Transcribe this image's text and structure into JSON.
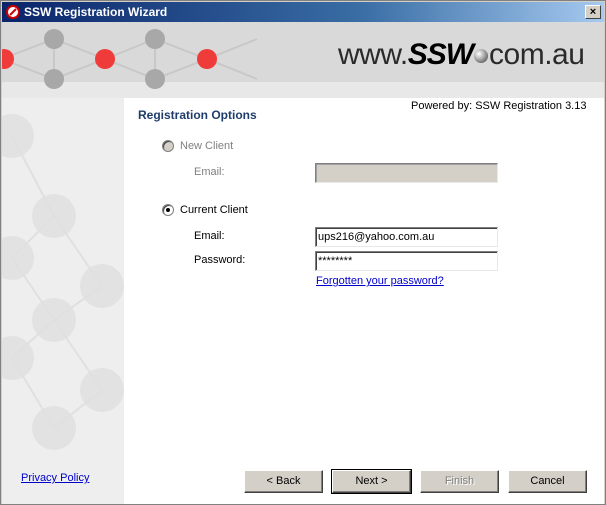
{
  "window": {
    "title": "SSW Registration Wizard",
    "close_glyph": "×"
  },
  "banner": {
    "logo_prefix": "www.",
    "logo_brand": "SSW",
    "logo_suffix": "com.au"
  },
  "header": {
    "powered_by": "Powered by: SSW Registration 3.13",
    "section_title": "Registration Options"
  },
  "form": {
    "new_client": {
      "label": "New Client",
      "selected": false,
      "enabled": false,
      "email_label": "Email:",
      "email_value": ""
    },
    "current_client": {
      "label": "Current Client",
      "selected": true,
      "email_label": "Email:",
      "email_value": "ups216@yahoo.com.au",
      "password_label": "Password:",
      "password_value": "********",
      "forgot_link": "Forgotten your password?"
    }
  },
  "footer": {
    "privacy_link": "Privacy Policy",
    "back_label": "< Back",
    "next_label": "Next >",
    "finish_label": "Finish",
    "cancel_label": "Cancel"
  },
  "colors": {
    "title_gradient_start": "#0a246a",
    "section_title": "#1f3d6b",
    "banner_red_dot": "#f03b3b",
    "banner_grey_dot": "#a8a8a8",
    "link": "#0000cc"
  },
  "icons": {
    "app": "ssw-app-icon",
    "close": "close-icon"
  }
}
